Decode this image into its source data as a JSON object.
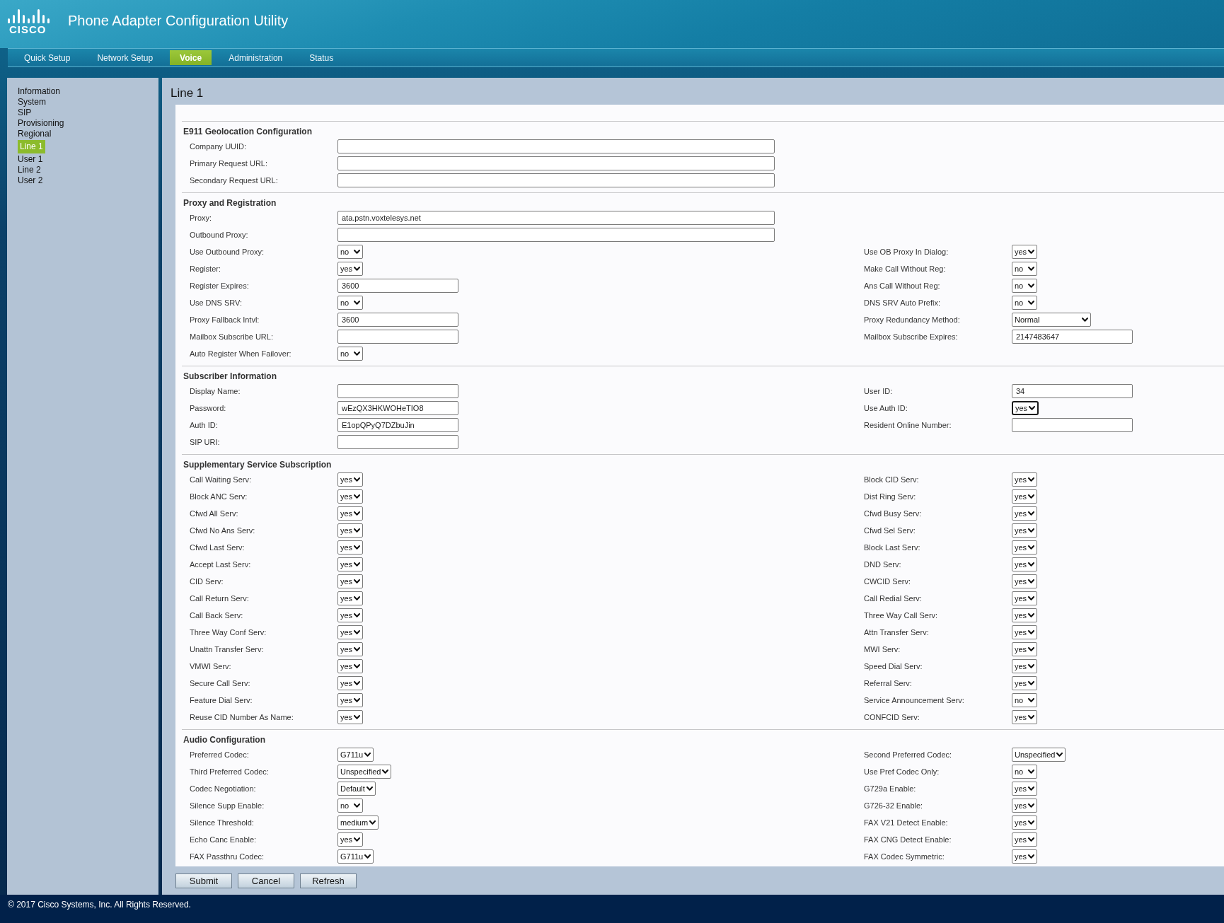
{
  "header": {
    "logo_text": "CISCO",
    "title": "Phone Adapter Configuration Utility"
  },
  "nav": [
    {
      "label": "Quick Setup",
      "selected": false
    },
    {
      "label": "Network Setup",
      "selected": false
    },
    {
      "label": "Voice",
      "selected": true
    },
    {
      "label": "Administration",
      "selected": false
    },
    {
      "label": "Status",
      "selected": false
    }
  ],
  "sidebar": {
    "items": [
      {
        "label": "Information",
        "selected": false
      },
      {
        "label": "System",
        "selected": false
      },
      {
        "label": "SIP",
        "selected": false
      },
      {
        "label": "Provisioning",
        "selected": false
      },
      {
        "label": "Regional",
        "selected": false
      },
      {
        "label": "Line 1",
        "selected": true
      },
      {
        "label": "User 1",
        "selected": false
      },
      {
        "label": "Line 2",
        "selected": false
      },
      {
        "label": "User 2",
        "selected": false
      }
    ]
  },
  "page": {
    "title": "Line 1",
    "sections": [
      {
        "title": "E911 Geolocation Configuration",
        "rows": [
          {
            "left": {
              "label": "Company UUID:",
              "kind": "long_field",
              "focused": false
            }
          },
          {
            "left": {
              "label": "Primary Request URL:",
              "kind": "long_field",
              "focused": false
            }
          },
          {
            "left": {
              "label": "Secondary Request URL:",
              "kind": "long_field",
              "focused": false
            }
          }
        ]
      },
      {
        "title": "Proxy and Registration",
        "rows": [
          {
            "left": {
              "label": "Proxy:",
              "kind": "long_field",
              "value": "ata.pstn.voxtelesys.net",
              "focused": false
            }
          },
          {
            "left": {
              "label": "Outbound Proxy:",
              "kind": "long_field",
              "focused": false
            }
          },
          {
            "left": {
              "label": "Use Outbound Proxy:",
              "kind": "select",
              "value": "no",
              "focused": false
            },
            "right": {
              "label": "Use OB Proxy In Dialog:",
              "kind": "select",
              "value": "yes",
              "focused": false
            }
          },
          {
            "left": {
              "label": "Register:",
              "kind": "select",
              "value": "yes",
              "focused": false
            },
            "right": {
              "label": "Make Call Without Reg:",
              "kind": "select",
              "value": "no",
              "focused": false
            }
          },
          {
            "left": {
              "label": "Register Expires:",
              "kind": "field",
              "value": "3600",
              "focused": false
            },
            "right": {
              "label": "Ans Call Without Reg:",
              "kind": "select",
              "value": "no",
              "focused": false
            }
          },
          {
            "left": {
              "label": "Use DNS SRV:",
              "kind": "select",
              "value": "no",
              "focused": false
            },
            "right": {
              "label": "DNS SRV Auto Prefix:",
              "kind": "select",
              "value": "no",
              "focused": false
            }
          },
          {
            "left": {
              "label": "Proxy Fallback Intvl:",
              "kind": "field",
              "value": "3600",
              "focused": false
            },
            "right": {
              "label": "Proxy Redundancy Method:",
              "kind": "long_select",
              "value": "Normal",
              "focused": false
            }
          },
          {
            "left": {
              "label": "Mailbox Subscribe URL:",
              "kind": "field",
              "focused": false
            },
            "right": {
              "label": "Mailbox Subscribe Expires:",
              "kind": "field",
              "value": "2147483647",
              "focused": false
            }
          },
          {
            "left": {
              "label": "Auto Register When Failover:",
              "kind": "select",
              "value": "no",
              "focused": false
            }
          }
        ]
      },
      {
        "title": "Subscriber Information",
        "rows": [
          {
            "left": {
              "label": "Display Name:",
              "kind": "field",
              "focused": false
            },
            "right": {
              "label": "User ID:",
              "kind": "field",
              "value": "34",
              "focused": false
            }
          },
          {
            "left": {
              "label": "Password:",
              "kind": "field",
              "value": "wEzQX3HKWOHeTIO8",
              "focused": false
            },
            "right": {
              "label": "Use Auth ID:",
              "kind": "select",
              "value": "yes",
              "focused": true
            }
          },
          {
            "left": {
              "label": "Auth ID:",
              "kind": "field",
              "value": "E1opQPyQ7DZbuJin",
              "focused": false
            },
            "right": {
              "label": "Resident Online Number:",
              "kind": "field",
              "focused": false
            }
          },
          {
            "left": {
              "label": "SIP URI:",
              "kind": "field",
              "focused": false
            }
          }
        ]
      },
      {
        "title": "Supplementary Service Subscription",
        "rows": [
          {
            "left": {
              "label": "Call Waiting Serv:",
              "kind": "select",
              "value": "yes",
              "focused": false
            },
            "right": {
              "label": "Block CID Serv:",
              "kind": "select",
              "value": "yes",
              "focused": false
            }
          },
          {
            "left": {
              "label": "Block ANC Serv:",
              "kind": "select",
              "value": "yes",
              "focused": false
            },
            "right": {
              "label": "Dist Ring Serv:",
              "kind": "select",
              "value": "yes",
              "focused": false
            }
          },
          {
            "left": {
              "label": "Cfwd All Serv:",
              "kind": "select",
              "value": "yes",
              "focused": false
            },
            "right": {
              "label": "Cfwd Busy Serv:",
              "kind": "select",
              "value": "yes",
              "focused": false
            }
          },
          {
            "left": {
              "label": "Cfwd No Ans Serv:",
              "kind": "select",
              "value": "yes",
              "focused": false
            },
            "right": {
              "label": "Cfwd Sel Serv:",
              "kind": "select",
              "value": "yes",
              "focused": false
            }
          },
          {
            "left": {
              "label": "Cfwd Last Serv:",
              "kind": "select",
              "value": "yes",
              "focused": false
            },
            "right": {
              "label": "Block Last Serv:",
              "kind": "select",
              "value": "yes",
              "focused": false
            }
          },
          {
            "left": {
              "label": "Accept Last Serv:",
              "kind": "select",
              "value": "yes",
              "focused": false
            },
            "right": {
              "label": "DND Serv:",
              "kind": "select",
              "value": "yes",
              "focused": false
            }
          },
          {
            "left": {
              "label": "CID Serv:",
              "kind": "select",
              "value": "yes",
              "focused": false
            },
            "right": {
              "label": "CWCID Serv:",
              "kind": "select",
              "value": "yes",
              "focused": false
            }
          },
          {
            "left": {
              "label": "Call Return Serv:",
              "kind": "select",
              "value": "yes",
              "focused": false
            },
            "right": {
              "label": "Call Redial Serv:",
              "kind": "select",
              "value": "yes",
              "focused": false
            }
          },
          {
            "left": {
              "label": "Call Back Serv:",
              "kind": "select",
              "value": "yes",
              "focused": false
            },
            "right": {
              "label": "Three Way Call Serv:",
              "kind": "select",
              "value": "yes",
              "focused": false
            }
          },
          {
            "left": {
              "label": "Three Way Conf Serv:",
              "kind": "select",
              "value": "yes",
              "focused": false
            },
            "right": {
              "label": "Attn Transfer Serv:",
              "kind": "select",
              "value": "yes",
              "focused": false
            }
          },
          {
            "left": {
              "label": "Unattn Transfer Serv:",
              "kind": "select",
              "value": "yes",
              "focused": false
            },
            "right": {
              "label": "MWI Serv:",
              "kind": "select",
              "value": "yes",
              "focused": false
            }
          },
          {
            "left": {
              "label": "VMWI Serv:",
              "kind": "select",
              "value": "yes",
              "focused": false
            },
            "right": {
              "label": "Speed Dial Serv:",
              "kind": "select",
              "value": "yes",
              "focused": false
            }
          },
          {
            "left": {
              "label": "Secure Call Serv:",
              "kind": "select",
              "value": "yes",
              "focused": false
            },
            "right": {
              "label": "Referral Serv:",
              "kind": "select",
              "value": "yes",
              "focused": false
            }
          },
          {
            "left": {
              "label": "Feature Dial Serv:",
              "kind": "select",
              "value": "yes",
              "focused": false
            },
            "right": {
              "label": "Service Announcement Serv:",
              "kind": "select",
              "value": "no",
              "focused": false
            }
          },
          {
            "left": {
              "label": "Reuse CID Number As Name:",
              "kind": "select",
              "value": "yes",
              "focused": false
            },
            "right": {
              "label": "CONFCID Serv:",
              "kind": "select",
              "value": "yes",
              "focused": false
            }
          }
        ]
      },
      {
        "title": "Audio Configuration",
        "rows": [
          {
            "left": {
              "label": "Preferred Codec:",
              "kind": "select",
              "value": "G711u",
              "focused": false
            },
            "right": {
              "label": "Second Preferred Codec:",
              "kind": "select",
              "value": "Unspecified",
              "focused": false
            }
          },
          {
            "left": {
              "label": "Third Preferred Codec:",
              "kind": "select",
              "value": "Unspecified",
              "focused": false
            },
            "right": {
              "label": "Use Pref Codec Only:",
              "kind": "select",
              "value": "no",
              "focused": false
            }
          },
          {
            "left": {
              "label": "Codec Negotiation:",
              "kind": "select",
              "value": "Default",
              "focused": false
            },
            "right": {
              "label": "G729a Enable:",
              "kind": "select",
              "value": "yes",
              "focused": false
            }
          },
          {
            "left": {
              "label": "Silence Supp Enable:",
              "kind": "select",
              "value": "no",
              "focused": false
            },
            "right": {
              "label": "G726-32 Enable:",
              "kind": "select",
              "value": "yes",
              "focused": false
            }
          },
          {
            "left": {
              "label": "Silence Threshold:",
              "kind": "select",
              "value": "medium",
              "focused": false
            },
            "right": {
              "label": "FAX V21 Detect Enable:",
              "kind": "select",
              "value": "yes",
              "focused": false
            }
          },
          {
            "left": {
              "label": "Echo Canc Enable:",
              "kind": "select",
              "value": "yes",
              "focused": false
            },
            "right": {
              "label": "FAX CNG Detect Enable:",
              "kind": "select",
              "value": "yes",
              "focused": false
            }
          },
          {
            "left": {
              "label": "FAX Passthru Codec:",
              "kind": "select",
              "value": "G711u",
              "focused": false
            },
            "right": {
              "label": "FAX Codec Symmetric:",
              "kind": "select",
              "value": "yes",
              "focused": false
            }
          }
        ]
      }
    ]
  },
  "buttons": [
    "Submit",
    "Cancel",
    "Refresh"
  ],
  "footer": "© 2017 Cisco Systems, Inc. All Rights Reserved."
}
